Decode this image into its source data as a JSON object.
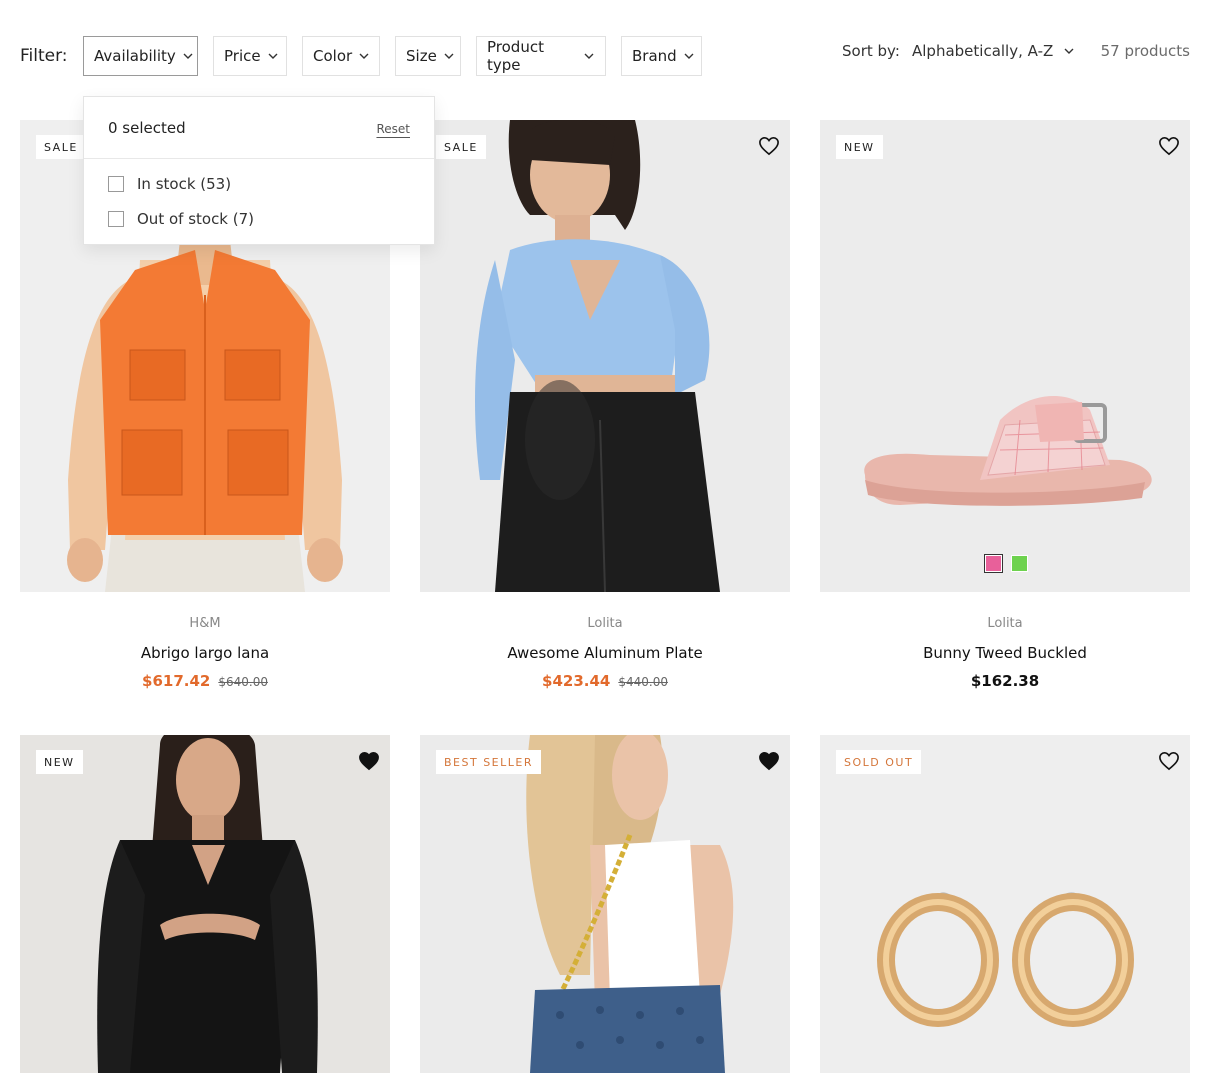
{
  "filter": {
    "label": "Filter:",
    "buttons": [
      "Availability",
      "Price",
      "Color",
      "Size",
      "Product type",
      "Brand"
    ]
  },
  "sort": {
    "label": "Sort by:",
    "value": "Alphabetically, A-Z"
  },
  "product_count": "57 products",
  "availability_dropdown": {
    "selected_text": "0 selected",
    "reset_label": "Reset",
    "options": [
      {
        "label": "In stock (53)",
        "checked": false
      },
      {
        "label": "Out of stock (7)",
        "checked": false
      }
    ]
  },
  "products": [
    {
      "badge": "SALE",
      "vendor": "H&M",
      "title": "Abrigo largo lana",
      "price": "$617.42",
      "compare_price": "$640.00",
      "wishlisted": false,
      "image": "orange-utility-vest"
    },
    {
      "badge": "SALE",
      "vendor": "Lolita",
      "title": "Awesome Aluminum Plate",
      "price": "$423.44",
      "compare_price": "$440.00",
      "wishlisted": false,
      "image": "blue-wrap-sweater"
    },
    {
      "badge": "NEW",
      "vendor": "Lolita",
      "title": "Bunny Tweed Buckled",
      "price": "$162.38",
      "compare_price": "",
      "wishlisted": false,
      "image": "pink-tweed-slide-sandal",
      "swatches": [
        "#e8609a",
        "#6ed24f"
      ]
    },
    {
      "badge": "NEW",
      "vendor": "",
      "title": "",
      "price": "",
      "compare_price": "",
      "wishlisted": true,
      "image": "black-cutout-dress"
    },
    {
      "badge": "BEST SELLER",
      "vendor": "",
      "title": "",
      "price": "",
      "compare_price": "",
      "wishlisted": true,
      "image": "denim-chain-shoulder-bag"
    },
    {
      "badge": "SOLD OUT",
      "vendor": "",
      "title": "",
      "price": "",
      "compare_price": "",
      "wishlisted": false,
      "image": "gold-hoop-earrings"
    }
  ],
  "colors": {
    "sale_price": "#e26a2c",
    "orange_badge": "#d4763a",
    "image_background": "#efefef"
  }
}
